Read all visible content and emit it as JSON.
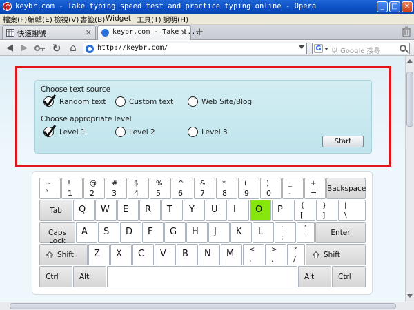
{
  "window": {
    "title": "keybr.com - Take typing speed test and practice typing online - Opera",
    "minimize": "_",
    "maximize": "□",
    "close": "✕"
  },
  "menu": [
    "檔案(F)",
    "編輯(E)",
    "檢視(V)",
    "書籤(B)",
    "Widget",
    "工具(T)",
    "說明(H)"
  ],
  "tabs": [
    {
      "label": "快速撥號",
      "close": "✕",
      "active": false
    },
    {
      "label": "keybr.com - Take t...",
      "close": "✕",
      "active": true
    }
  ],
  "new_tab": "+",
  "nav": {
    "back": "◀",
    "forward": "▶",
    "reload": "↻",
    "home": "⌂",
    "address": "http://keybr.com/",
    "search_engine": "G",
    "search_placeholder": "以 Google 搜尋"
  },
  "panel": {
    "source_heading": "Choose text source",
    "sources": [
      {
        "label": "Random text",
        "checked": true
      },
      {
        "label": "Custom text",
        "checked": false
      },
      {
        "label": "Web Site/Blog",
        "checked": false
      }
    ],
    "level_heading": "Choose appropriate level",
    "levels": [
      {
        "label": "Level 1",
        "checked": true
      },
      {
        "label": "Level 2",
        "checked": false
      },
      {
        "label": "Level 3",
        "checked": false
      }
    ],
    "start": "Start"
  },
  "keyboard": {
    "row1": [
      {
        "top": "~",
        "bot": "`"
      },
      {
        "top": "!",
        "bot": "1"
      },
      {
        "top": "@",
        "bot": "2"
      },
      {
        "top": "#",
        "bot": "3"
      },
      {
        "top": "$",
        "bot": "4"
      },
      {
        "top": "%",
        "bot": "5"
      },
      {
        "top": "^",
        "bot": "6"
      },
      {
        "top": "&",
        "bot": "7"
      },
      {
        "top": "*",
        "bot": "8"
      },
      {
        "top": "(",
        "bot": "9"
      },
      {
        "top": ")",
        "bot": "0"
      },
      {
        "top": "_",
        "bot": "-"
      },
      {
        "top": "+",
        "bot": "="
      }
    ],
    "backspace": "Backspace",
    "tab": "Tab",
    "row2": [
      "Q",
      "W",
      "E",
      "R",
      "T",
      "Y",
      "U",
      "I",
      "O",
      "P"
    ],
    "row2_sym": [
      {
        "top": "{",
        "bot": "["
      },
      {
        "top": "}",
        "bot": "]"
      },
      {
        "top": "|",
        "bot": "\\"
      }
    ],
    "caps": "Caps Lock",
    "row3": [
      "A",
      "S",
      "D",
      "F",
      "G",
      "H",
      "J",
      "K",
      "L"
    ],
    "row3_sym": [
      {
        "top": ":",
        "bot": ";"
      },
      {
        "top": "\"",
        "bot": "'"
      }
    ],
    "enter": "Enter",
    "shift_left": "Shift",
    "row4": [
      "Z",
      "X",
      "C",
      "V",
      "B",
      "N",
      "M"
    ],
    "row4_sym": [
      {
        "top": "<",
        "bot": ","
      },
      {
        "top": ">",
        "bot": "."
      },
      {
        "top": "?",
        "bot": "/"
      }
    ],
    "shift_right": "Shift",
    "ctrl_left": "Ctrl",
    "alt_left": "Alt",
    "alt_right": "Alt",
    "ctrl_right": "Ctrl",
    "highlighted_key": "O",
    "highlight_color": "#86e60d"
  }
}
